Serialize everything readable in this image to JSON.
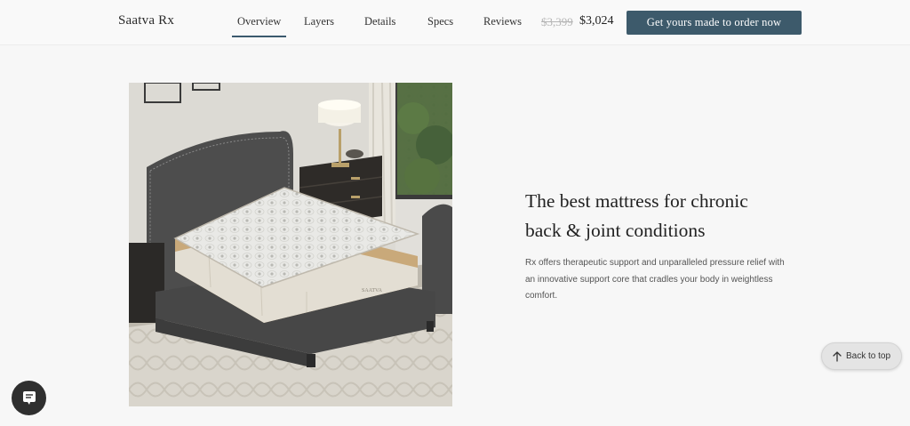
{
  "header": {
    "brand": "Saatva Rx",
    "nav": [
      {
        "label": "Overview",
        "active": true
      },
      {
        "label": "Layers",
        "active": false
      },
      {
        "label": "Details",
        "active": false
      },
      {
        "label": "Specs",
        "active": false
      },
      {
        "label": "Reviews",
        "active": false
      }
    ],
    "price_original": "$3,399",
    "price_current": "$3,024",
    "cta_label": "Get yours made to order now"
  },
  "hero": {
    "image_icon": "mattress-bedroom-photo"
  },
  "content": {
    "headline_line1": "The best mattress for chronic",
    "headline_line2": "back & joint conditions",
    "description": "Rx offers therapeutic support and unparalleled pressure relief with an innovative support core that cradles your body in weightless comfort."
  },
  "widgets": {
    "back_to_top_label": "Back to top",
    "back_to_top_icon": "arrow-up-icon",
    "chat_icon": "chat-bubble-icon"
  },
  "colors": {
    "accent": "#3d5a6b",
    "background": "#f7f7f7"
  }
}
